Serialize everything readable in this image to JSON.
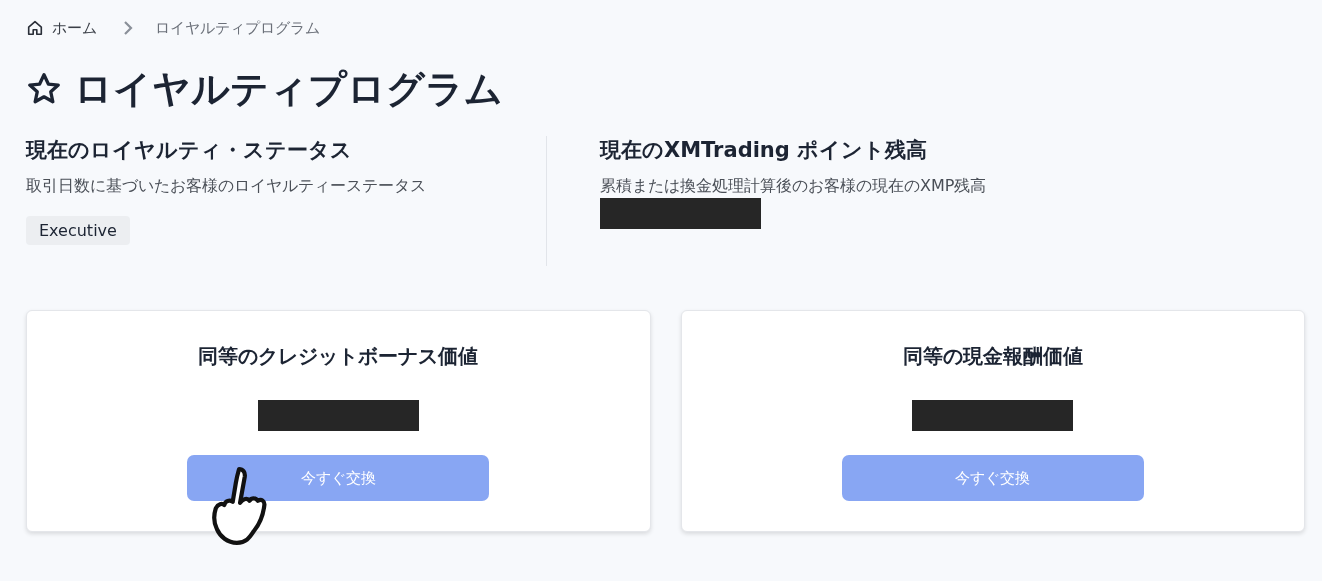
{
  "breadcrumb": [
    {
      "label": "ホーム",
      "kind": "home"
    },
    {
      "label": "ロイヤルティプログラム",
      "kind": "current"
    }
  ],
  "title": "ロイヤルティプログラム",
  "status": [
    {
      "heading": "現在のロイヤルティ・ステータス",
      "description": "取引日数に基づいたお客様のロイヤルティーステータス",
      "kind": "badge",
      "value": "Executive"
    },
    {
      "heading": "現在のXMTrading ポイント残高",
      "description": "累積または換金処理計算後のお客様の現在のXMP残高",
      "kind": "redacted"
    }
  ],
  "cards": [
    {
      "title": "同等のクレジットボーナス価値",
      "button": "今すぐ交換",
      "pointer": true
    },
    {
      "title": "同等の現金報酬価値",
      "button": "今すぐ交換",
      "pointer": false
    }
  ]
}
